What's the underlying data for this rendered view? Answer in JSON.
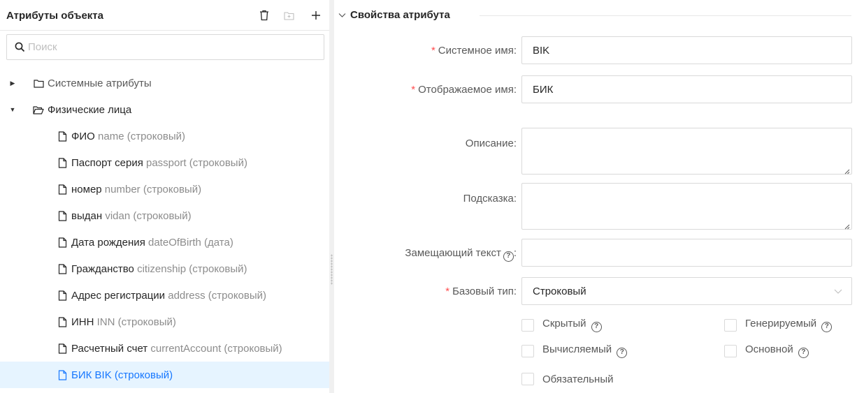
{
  "left": {
    "title": "Атрибуты объекта",
    "icons": {
      "delete": "trash-icon",
      "add_folder": "folder-plus-icon",
      "add": "plus-icon"
    },
    "search_placeholder": "Поиск",
    "folders": [
      {
        "label": "Системные атрибуты",
        "expanded": false
      },
      {
        "label": "Физические лица",
        "expanded": true
      }
    ],
    "items": [
      {
        "name": "ФИО",
        "detail": "name (строковый)"
      },
      {
        "name": "Паспорт серия",
        "detail": "passport (строковый)"
      },
      {
        "name": "номер",
        "detail": "number (строковый)"
      },
      {
        "name": "выдан",
        "detail": "vidan (строковый)"
      },
      {
        "name": "Дата рождения",
        "detail": "dateOfBirth (дата)"
      },
      {
        "name": "Гражданство",
        "detail": "citizenship (строковый)"
      },
      {
        "name": "Адрес регистрации",
        "detail": "address (строковый)"
      },
      {
        "name": "ИНН",
        "detail": "INN (строковый)"
      },
      {
        "name": "Расчетный счет",
        "detail": "currentAccount (строковый)"
      },
      {
        "name": "БИК",
        "detail": "BIK (строковый)",
        "selected": true
      }
    ]
  },
  "right": {
    "section_title": "Свойства атрибута",
    "fields": {
      "system_name": {
        "label": "Системное имя",
        "value": "BIK"
      },
      "display_name": {
        "label": "Отображаемое имя",
        "value": "БИК"
      },
      "description": {
        "label": "Описание",
        "value": ""
      },
      "hint": {
        "label": "Подсказка",
        "value": ""
      },
      "placeholder_text": {
        "label": "Замещающий текст",
        "value": ""
      },
      "base_type": {
        "label": "Базовый тип",
        "value": "Строковый"
      }
    },
    "checkboxes": {
      "hidden": {
        "label": "Скрытый",
        "checked": false
      },
      "generated": {
        "label": "Генерируемый",
        "checked": false
      },
      "computed": {
        "label": "Вычисляемый",
        "checked": false
      },
      "primary": {
        "label": "Основной",
        "checked": false
      },
      "required": {
        "label": "Обязательный",
        "checked": false
      }
    }
  },
  "colors": {
    "accent": "#1677ff",
    "selected_bg": "#e6f4ff",
    "required": "#ff4d4f",
    "border": "#d9d9d9"
  }
}
